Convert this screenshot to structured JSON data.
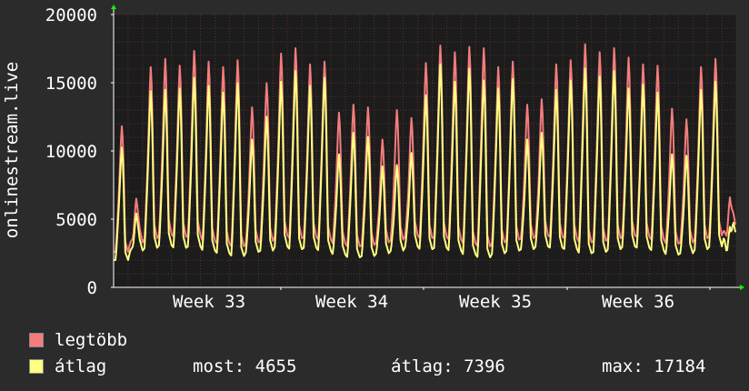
{
  "chart_data": {
    "type": "line",
    "ylabel": "onlinestream.live",
    "ylim": [
      0,
      20000
    ],
    "yticks": [
      "0",
      "5000",
      "10000",
      "15000",
      "20000"
    ],
    "xticks": [
      "Week 33",
      "Week 34",
      "Week 35",
      "Week 36"
    ],
    "grid": true,
    "series": [
      {
        "name": "legtöbb",
        "color": "#f47c7c",
        "daily_peaks": [
          12000,
          6600,
          16400,
          17000,
          16500,
          17600,
          16800,
          16400,
          16900,
          13400,
          15200,
          17400,
          17800,
          16600,
          16800,
          13000,
          13600,
          13400,
          11000,
          13200,
          12600,
          16700,
          18000,
          17500,
          17900,
          17800,
          16400,
          16800,
          13600,
          14000,
          16600,
          16900,
          18100,
          17500,
          17800,
          17100,
          16600,
          16500,
          13300,
          12500,
          16400,
          17000,
          6700
        ],
        "daily_lows": [
          2600,
          3300,
          3600,
          3900,
          3700,
          3800,
          3400,
          3200,
          3000,
          3300,
          3400,
          3800,
          3600,
          3700,
          3500,
          3200,
          3000,
          3100,
          3300,
          3500,
          3800,
          3600,
          3700,
          3500,
          3200,
          3000,
          3300,
          3500,
          3600,
          3800,
          3700,
          3600,
          3300,
          3400,
          3600,
          3800,
          3700,
          3500,
          3200,
          3300,
          3600,
          3800,
          4200
        ]
      },
      {
        "name": "átlag",
        "color": "#ffff80",
        "daily_peaks": [
          10400,
          5500,
          14600,
          14700,
          14800,
          15600,
          15000,
          14500,
          15200,
          11000,
          12700,
          15300,
          16100,
          15000,
          15600,
          9900,
          11500,
          11200,
          9000,
          9100,
          10000,
          14300,
          16600,
          15300,
          16300,
          15400,
          14800,
          15500,
          11000,
          11500,
          14700,
          15400,
          16300,
          15700,
          16100,
          14800,
          15100,
          14500,
          9900,
          9800,
          14700,
          15300,
          4500
        ],
        "daily_lows": [
          2000,
          2700,
          2900,
          3100,
          2900,
          3000,
          2700,
          2500,
          2300,
          2600,
          2700,
          3000,
          2800,
          2900,
          2700,
          2400,
          2200,
          2300,
          2500,
          2700,
          3000,
          2800,
          2900,
          2700,
          2400,
          2200,
          2500,
          2700,
          2800,
          3000,
          2900,
          2800,
          2500,
          2600,
          2800,
          3000,
          2900,
          2700,
          2400,
          2500,
          2800,
          3000,
          3700
        ]
      }
    ]
  },
  "legend": {
    "max_label": "legtöbb",
    "max_color": "#f47c7c",
    "avg_label": "átlag",
    "avg_color": "#ffff80",
    "stat_now": "most: 4655",
    "stat_avg": "átlag: 7396",
    "stat_max": "max: 17184"
  },
  "colors": {
    "background": "#2b2b2b",
    "plot_background": "#1c1c1c",
    "grid": "#5a3030",
    "axis": "#ffffff",
    "arrow": "#00ff00"
  }
}
